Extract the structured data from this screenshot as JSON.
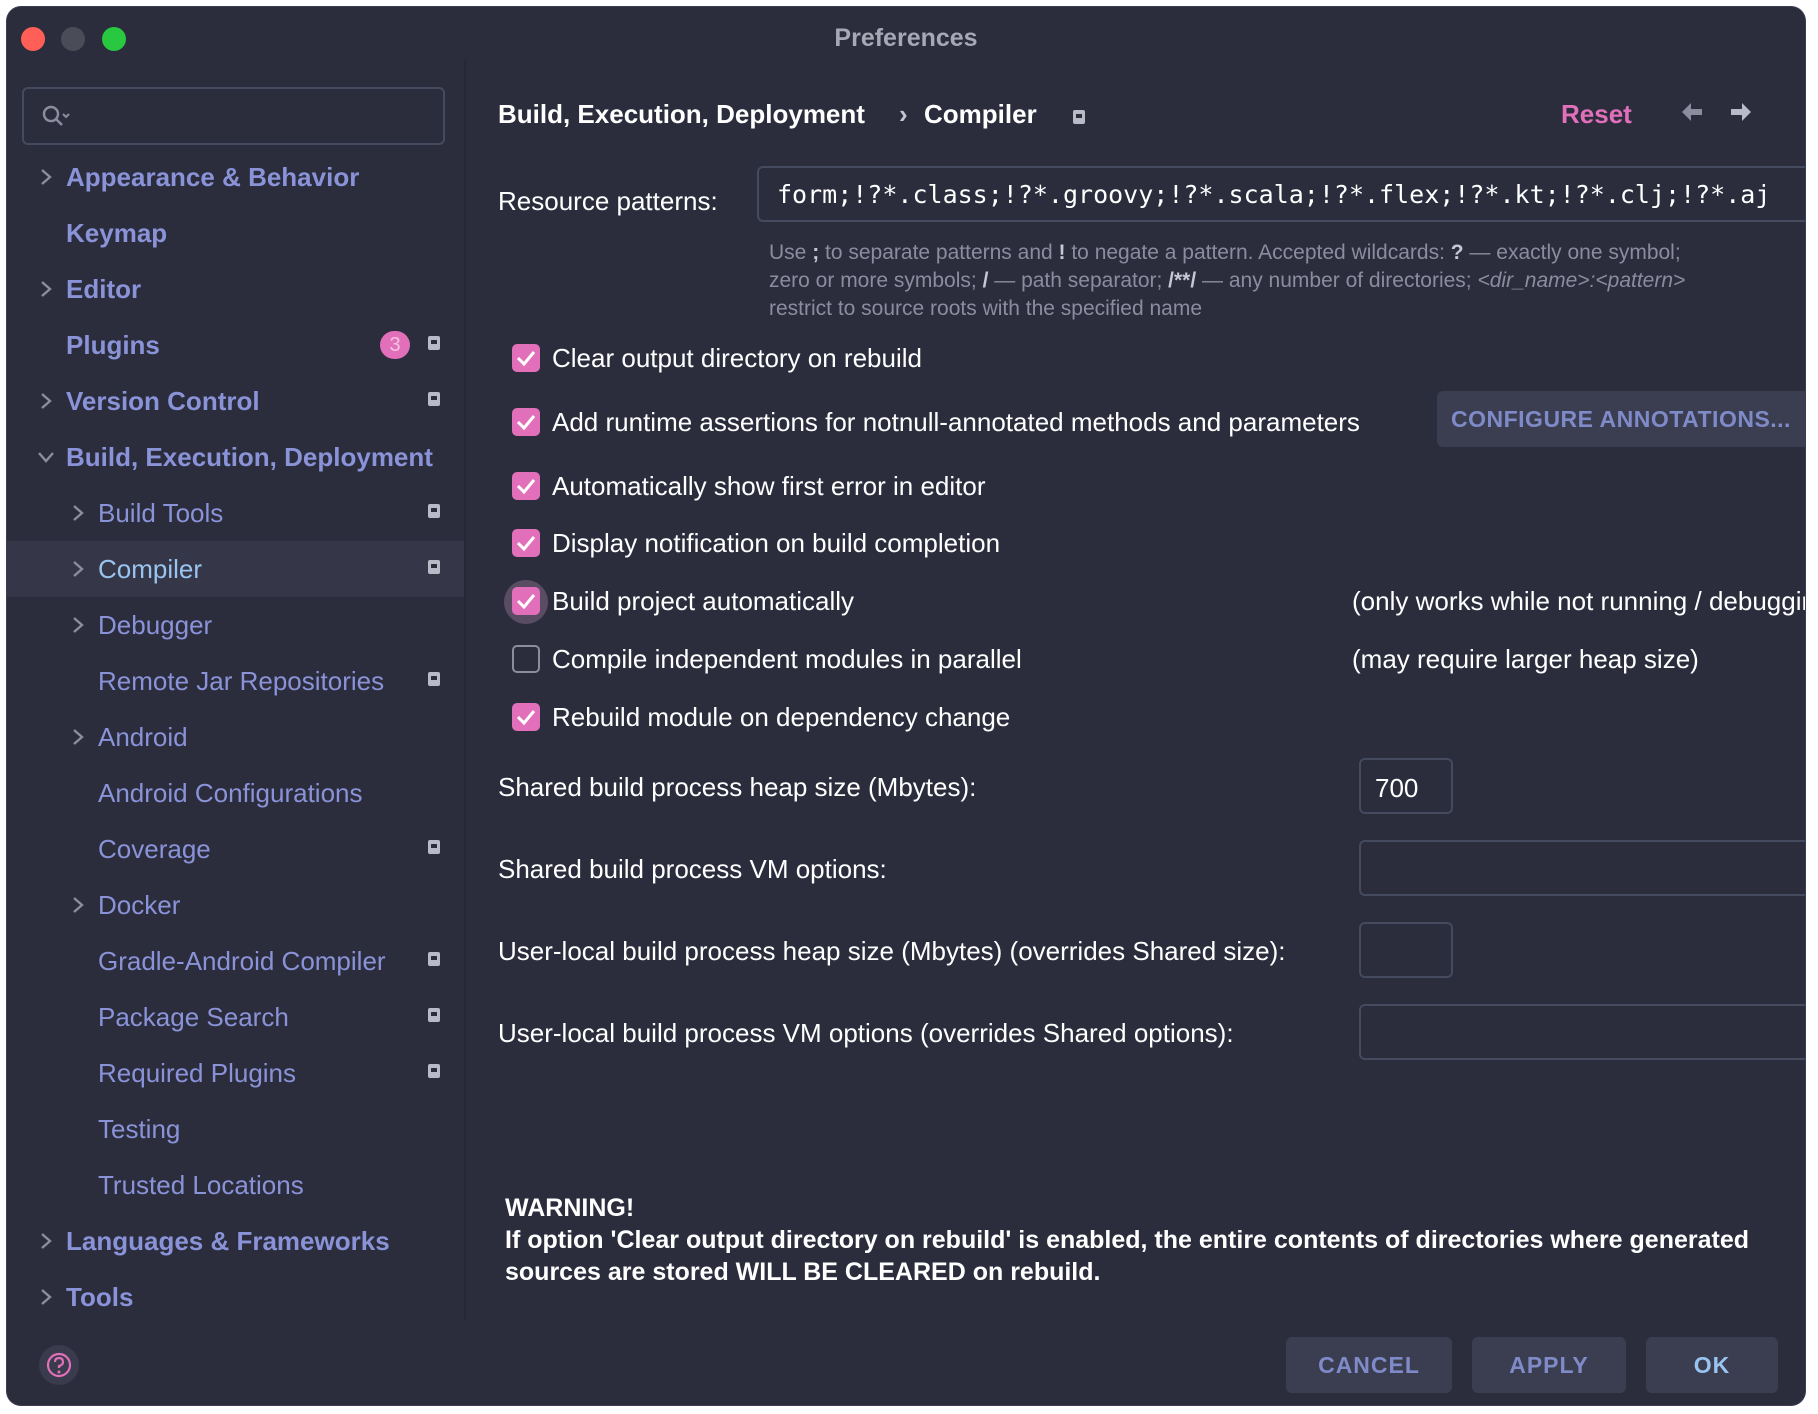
{
  "window": {
    "title": "Preferences"
  },
  "search": {
    "placeholder": ""
  },
  "sidebar": {
    "items": [
      {
        "label": "Appearance & Behavior",
        "level": 0,
        "chevron": "right",
        "gear": false
      },
      {
        "label": "Keymap",
        "level": 0,
        "chevron": "none",
        "gear": false
      },
      {
        "label": "Editor",
        "level": 0,
        "chevron": "right",
        "gear": false
      },
      {
        "label": "Plugins",
        "level": 0,
        "chevron": "none",
        "gear": true,
        "badge": "3"
      },
      {
        "label": "Version Control",
        "level": 0,
        "chevron": "right",
        "gear": true
      },
      {
        "label": "Build, Execution, Deployment",
        "level": 0,
        "chevron": "down",
        "gear": false
      },
      {
        "label": "Build Tools",
        "level": 1,
        "chevron": "right",
        "gear": true
      },
      {
        "label": "Compiler",
        "level": 1,
        "chevron": "right",
        "gear": true,
        "selected": true
      },
      {
        "label": "Debugger",
        "level": 1,
        "chevron": "right",
        "gear": false
      },
      {
        "label": "Remote Jar Repositories",
        "level": 1,
        "chevron": "none",
        "gear": true
      },
      {
        "label": "Android",
        "level": 1,
        "chevron": "right",
        "gear": false
      },
      {
        "label": "Android Configurations",
        "level": 1,
        "chevron": "none",
        "gear": false
      },
      {
        "label": "Coverage",
        "level": 1,
        "chevron": "none",
        "gear": true
      },
      {
        "label": "Docker",
        "level": 1,
        "chevron": "right",
        "gear": false
      },
      {
        "label": "Gradle-Android Compiler",
        "level": 1,
        "chevron": "none",
        "gear": true
      },
      {
        "label": "Package Search",
        "level": 1,
        "chevron": "none",
        "gear": true
      },
      {
        "label": "Required Plugins",
        "level": 1,
        "chevron": "none",
        "gear": true
      },
      {
        "label": "Testing",
        "level": 1,
        "chevron": "none",
        "gear": false
      },
      {
        "label": "Trusted Locations",
        "level": 1,
        "chevron": "none",
        "gear": false
      },
      {
        "label": "Languages & Frameworks",
        "level": 0,
        "chevron": "right",
        "gear": false
      },
      {
        "label": "Tools",
        "level": 0,
        "chevron": "right",
        "gear": false
      }
    ]
  },
  "header": {
    "breadcrumb_parent": "Build, Execution, Deployment",
    "breadcrumb_separator": "›",
    "breadcrumb_current": "Compiler",
    "reset_label": "Reset"
  },
  "resource_patterns": {
    "label": "Resource patterns:",
    "value": "form;!?*.class;!?*.groovy;!?*.scala;!?*.flex;!?*.kt;!?*.clj;!?*.aj",
    "hint_line1_a": "Use ",
    "hint_line1_b": ";",
    "hint_line1_c": " to separate patterns and ",
    "hint_line1_d": "!",
    "hint_line1_e": " to negate a pattern. Accepted wildcards: ",
    "hint_line1_f": "?",
    "hint_line1_g": " — exactly one symbol; ",
    "hint_line2_a": "zero or more symbols; ",
    "hint_line2_b": "/",
    "hint_line2_c": " — path separator; ",
    "hint_line2_d": "/**/",
    "hint_line2_e": " — any number of directories; ",
    "hint_line2_f": "<dir_name>:<pattern>",
    "hint_line3": "restrict to source roots with the specified name"
  },
  "options": [
    {
      "label": "Clear output directory on rebuild",
      "checked": true
    },
    {
      "label": "Add runtime assertions for notnull-annotated methods and parameters",
      "checked": true
    },
    {
      "label": "Automatically show first error in editor",
      "checked": true
    },
    {
      "label": "Display notification on build completion",
      "checked": true
    },
    {
      "label": "Build project automatically",
      "checked": true,
      "note": "(only works while not running / debugging)"
    },
    {
      "label": "Compile independent modules in parallel",
      "checked": false,
      "note": "(may require larger heap size)"
    },
    {
      "label": "Rebuild module on dependency change",
      "checked": true
    }
  ],
  "configure_annotations_label": "CONFIGURE ANNOTATIONS...",
  "fields": {
    "shared_heap_label": "Shared build process heap size (Mbytes):",
    "shared_heap_value": "700",
    "shared_vm_label": "Shared build process VM options:",
    "shared_vm_value": "",
    "user_heap_label": "User-local build process heap size (Mbytes) (overrides Shared size):",
    "user_heap_value": "",
    "user_vm_label": "User-local build process VM options (overrides Shared options):",
    "user_vm_value": ""
  },
  "warning": {
    "title": "WARNING!",
    "body": "If option 'Clear output directory on rebuild' is enabled, the entire contents of directories where generated sources are stored WILL BE CLEARED on rebuild."
  },
  "buttons": {
    "cancel": "CANCEL",
    "apply": "APPLY",
    "ok": "OK"
  },
  "colors": {
    "background": "#2b2d3d",
    "accent": "#e26fb9",
    "link": "#8a93d8",
    "selected_text": "#9ac4f0"
  }
}
